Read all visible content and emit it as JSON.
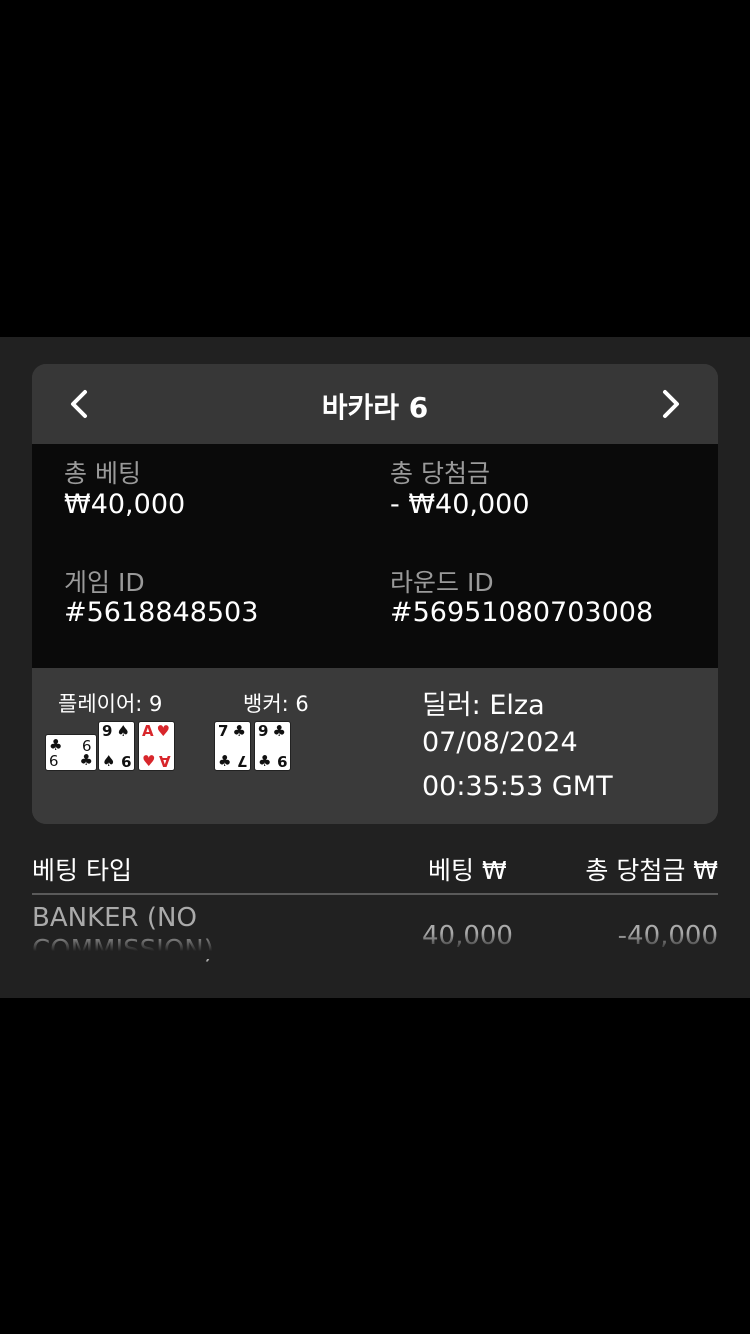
{
  "header": {
    "title": "바카라 6"
  },
  "summary": {
    "total_bet_label": "총 베팅",
    "total_bet_value": "₩40,000",
    "total_win_label": "총 당첨금",
    "total_win_value": "- ₩40,000",
    "game_id_label": "게임 ID",
    "game_id_value": "#5618848503",
    "round_id_label": "라운드 ID",
    "round_id_value": "#56951080703008"
  },
  "result": {
    "player_label": "플레이어: 9",
    "banker_label": "뱅커: 6",
    "player_cards": [
      {
        "rank": "9",
        "suit": "♣",
        "color": "black",
        "sideways": true
      },
      {
        "rank": "9",
        "suit": "♠",
        "color": "black",
        "sideways": false
      },
      {
        "rank": "A",
        "suit": "♥",
        "color": "red",
        "sideways": false
      }
    ],
    "banker_cards": [
      {
        "rank": "7",
        "suit": "♣",
        "color": "black",
        "sideways": false
      },
      {
        "rank": "9",
        "suit": "♣",
        "color": "black",
        "sideways": false
      }
    ],
    "dealer": "딜러: Elza",
    "date": "07/08/2024",
    "time": "00:35:53 GMT"
  },
  "table": {
    "col_type": "베팅 타입",
    "col_bet": "베팅 ₩",
    "col_win": "총 당첨금 ₩",
    "rows": [
      {
        "type_line1": "BANKER (NO",
        "type_line2": "COMMISSION)",
        "bet": "40,000",
        "win": "-40,000"
      }
    ]
  },
  "icons": {
    "prev": "chevron-left-icon",
    "next": "chevron-right-icon"
  }
}
